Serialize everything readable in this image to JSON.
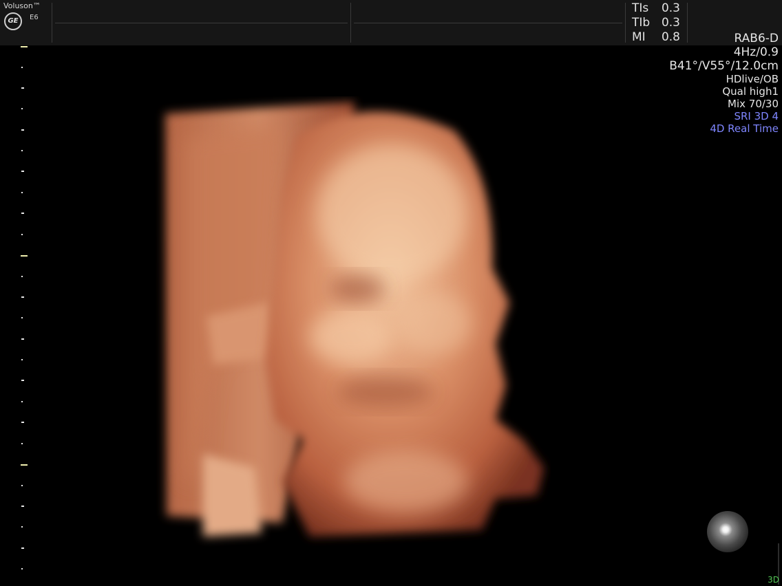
{
  "system": {
    "brand": "Voluson™",
    "logo_text": "GE",
    "model": "E6"
  },
  "safety": [
    {
      "label": "TIs",
      "value": "0.3"
    },
    {
      "label": "TIb",
      "value": "0.3"
    },
    {
      "label": "MI",
      "value": "0.8"
    }
  ],
  "params": {
    "probe": "RAB6-D",
    "frequency": "4Hz/0.9",
    "angles": "B41°/V55°/12.0cm",
    "preset": "HDlive/OB",
    "quality": "Qual high1",
    "mix": "Mix 70/30",
    "sri": "SRI 3D 4",
    "mode": "4D Real Time"
  },
  "footer": {
    "mode_label": "3D"
  },
  "colors": {
    "accent_blue": "#7f86ff",
    "mode_green": "#55c957",
    "scale_yellow": "#f1f0b0"
  }
}
